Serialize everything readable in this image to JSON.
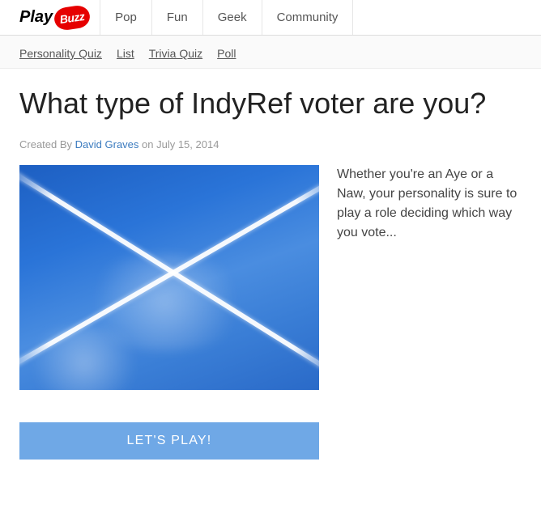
{
  "logo": {
    "part1": "Play",
    "part2": "Buzz"
  },
  "nav": [
    "Pop",
    "Fun",
    "Geek",
    "Community"
  ],
  "subnav": [
    "Personality Quiz",
    "List",
    "Trivia Quiz",
    "Poll"
  ],
  "title": "What type of IndyRef voter are you?",
  "byline": {
    "prefix": "Created By ",
    "author": "David Graves",
    "suffix": " on July 15, 2014"
  },
  "description": "Whether you're an Aye or a Naw, your personality is sure to play a role deciding which way you vote...",
  "play_button": "LET'S PLAY!"
}
